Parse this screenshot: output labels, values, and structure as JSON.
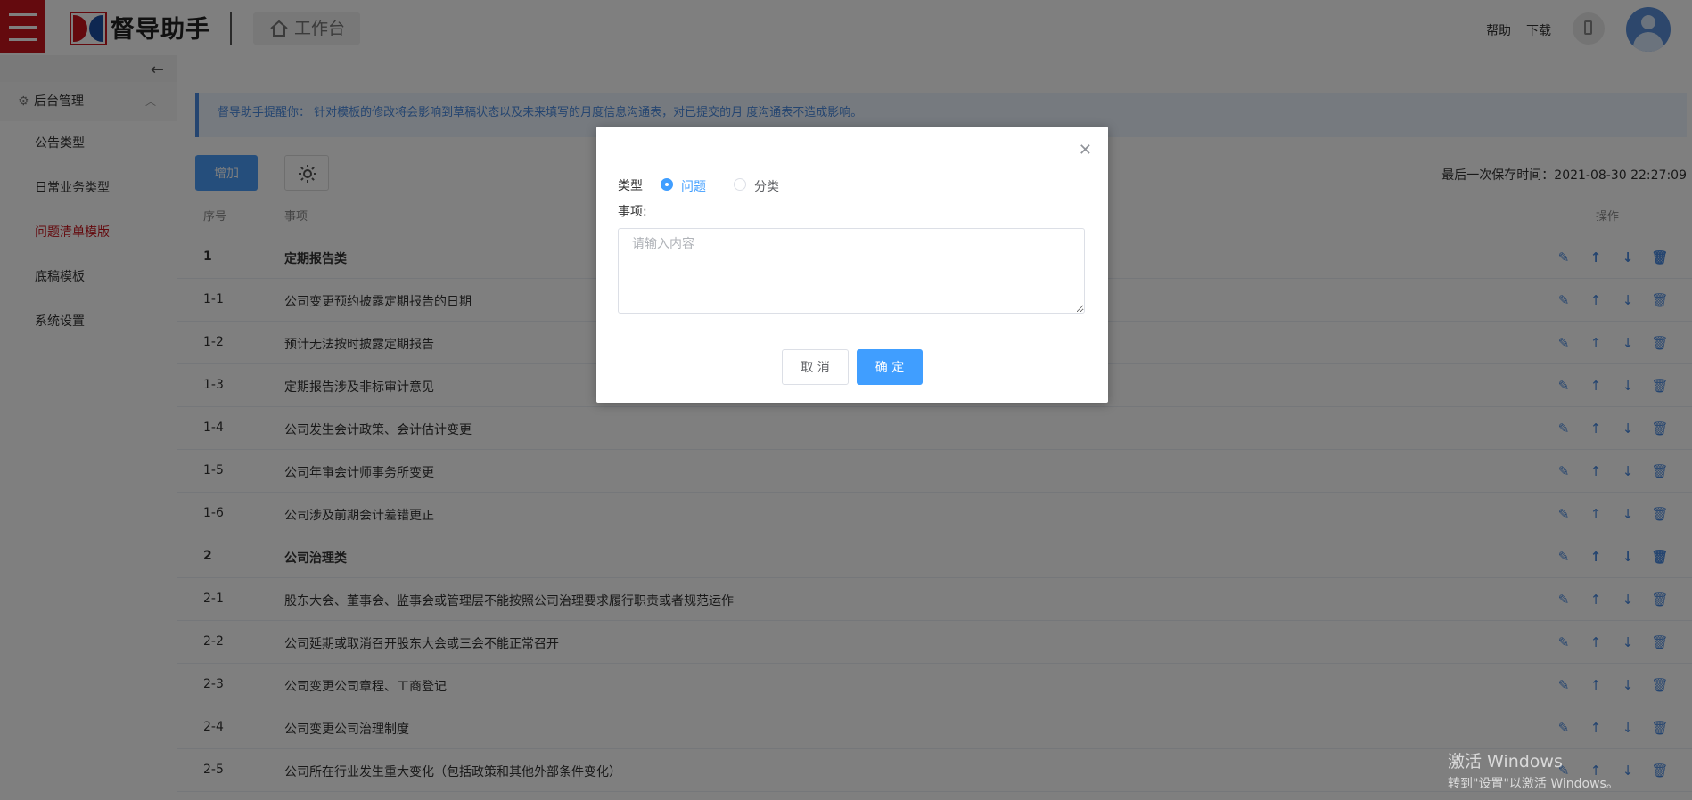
{
  "header": {
    "logo_text": "督导助手",
    "workbench_label": "工作台",
    "help_label": "帮助",
    "download_label": "下载"
  },
  "sidebar": {
    "group_label": "后台管理",
    "items": [
      {
        "label": "公告类型",
        "active": false
      },
      {
        "label": "日常业务类型",
        "active": false
      },
      {
        "label": "问题清单模版",
        "active": true
      },
      {
        "label": "底稿模板",
        "active": false
      },
      {
        "label": "系统设置",
        "active": false
      }
    ]
  },
  "main": {
    "notice": "督导助手提醒你：  针对模板的修改将会影响到草稿状态以及未来填写的月度信息沟通表，对已提交的月 度沟通表不造成影响。",
    "add_label": "增加",
    "save_time": "最后一次保存时间：2021-08-30 22:27:09",
    "table": {
      "headers": {
        "no": "序号",
        "item": "事项",
        "ops": "操作"
      },
      "rows": [
        {
          "no": "1",
          "text": "定期报告类",
          "category": true
        },
        {
          "no": "1-1",
          "text": "公司变更预约披露定期报告的日期",
          "category": false
        },
        {
          "no": "1-2",
          "text": "预计无法按时披露定期报告",
          "category": false
        },
        {
          "no": "1-3",
          "text": "定期报告涉及非标审计意见",
          "category": false
        },
        {
          "no": "1-4",
          "text": "公司发生会计政策、会计估计变更",
          "category": false
        },
        {
          "no": "1-5",
          "text": "公司年审会计师事务所变更",
          "category": false
        },
        {
          "no": "1-6",
          "text": "公司涉及前期会计差错更正",
          "category": false
        },
        {
          "no": "2",
          "text": "公司治理类",
          "category": true
        },
        {
          "no": "2-1",
          "text": "股东大会、董事会、监事会或管理层不能按照公司治理要求履行职责或者规范运作",
          "category": false
        },
        {
          "no": "2-2",
          "text": "公司延期或取消召开股东大会或三会不能正常召开",
          "category": false
        },
        {
          "no": "2-3",
          "text": "公司变更公司章程、工商登记",
          "category": false
        },
        {
          "no": "2-4",
          "text": "公司变更公司治理制度",
          "category": false
        },
        {
          "no": "2-5",
          "text": "公司所在行业发生重大变化（包括政策和其他外部条件变化）",
          "category": false
        }
      ]
    }
  },
  "modal": {
    "type_label": "类型",
    "radio_question": "问题",
    "radio_category": "分类",
    "selected": "问题",
    "item_label": "事项:",
    "item_placeholder": "请输入内容",
    "item_value": "",
    "cancel_label": "取 消",
    "confirm_label": "确 定"
  },
  "watermark": {
    "line1": "激活 Windows",
    "line2": "转到\"设置\"以激活 Windows。"
  },
  "colors": {
    "brand_red": "#c8151d",
    "primary_blue": "#409eff",
    "notice_blue": "#4a8ae0"
  }
}
